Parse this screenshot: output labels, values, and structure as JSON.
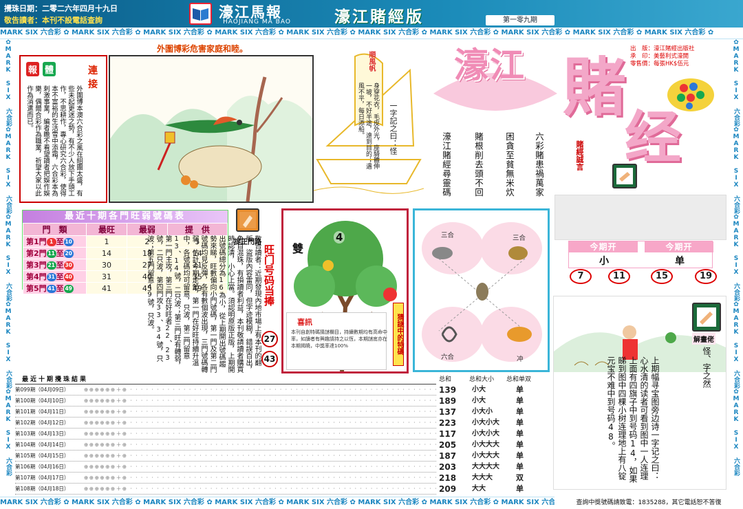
{
  "header": {
    "date": "攪珠日期：二零二六年四月十九日",
    "warning": "敬告讀者：本刊不設電話查詢",
    "paper_name": "濠江馬報",
    "paper_pinyin": "HAOJIANG MA BAO",
    "edition_title": "濠江賭經版",
    "issue_no": "第一零九期"
  },
  "frame": {
    "band_text": "MARK SIX 六合彩 ✿ MARK SIX 六合彩 ✿ MARK SIX 六合彩 ✿ MARK SIX 六合彩 ✿ MARK SIX 六合彩 ✿ MARK SIX 六合彩 ✿ MARK SIX 六合彩 ✿ MARK SIX 六合彩 ✿ MARK SIX 六合彩 ✿ MARK SIX 六合彩 ✿",
    "side_text": "✿MARK SIX 六合彩✿MARK SIX 六合彩✿MARK SIX 六合彩✿MARK SIX 六合彩✿MARK SIX 六合彩✿MARK SIX 六合彩✿MARK SIX 六合彩✿MARK SIX 六合彩"
  },
  "story": {
    "caption": "外圍博彩危害家庭和睦。",
    "tag_1": "報",
    "tag_2": "體",
    "heading": "連接",
    "text": "外圍博本澳六合彩之風在組團太盛，有些未起更迷之勢，有不少人放下手頭工作，不思耕作，專心研究六合彩，使得本不富裕的生活雪中添霜，六合彩本為刺激事業，編者瞻不看望讀者把娛作娛樂，偶爾合彩作為職業，祈望大家以此作為消遣而已。"
  },
  "ship": {
    "title": "順風帆",
    "heading": "一字記之曰：怪",
    "poem": "身穿花衣，毛皮外光，座騎體伸一坡，不好半途，遠到目的；遇風不平，每日添船。"
  },
  "proverbs": [
    "六彩賭患禍萬家",
    "困貪至貧無米炊",
    "賭根削去頭不回",
    "濠江賭經尋靈碼"
  ],
  "brand": {
    "title_1": "濠江",
    "title_2": "賭",
    "title_3": "经",
    "motto": "賭經誠言",
    "publisher_lines": [
      "出　版：濠江賭經出版社",
      "承　印：美藝利式濠開",
      "零售價：每張HK$伍元"
    ]
  },
  "stats_table": {
    "title": "最近十期各門旺弱號碼表",
    "headers": [
      "門　類",
      "最旺",
      "最弱",
      "提　供"
    ],
    "rows": [
      {
        "label": "第1門",
        "from": "1",
        "to": "10",
        "from_color": "#e33",
        "to_color": "#2b78d8",
        "hot": "1",
        "cold": "2",
        "offer": "5"
      },
      {
        "label": "第2門",
        "from": "11",
        "to": "20",
        "from_color": "#18a850",
        "to_color": "#2b78d8",
        "hot": "14",
        "cold": "18",
        "offer": "14"
      },
      {
        "label": "第3門",
        "from": "21",
        "to": "30",
        "from_color": "#18a850",
        "to_color": "#e33",
        "hot": "30",
        "cold": "27",
        "offer": "21"
      },
      {
        "label": "第4門",
        "from": "31",
        "to": "40",
        "from_color": "#2b78d8",
        "to_color": "#e33",
        "hot": "31",
        "cold": "40",
        "offer": "35"
      },
      {
        "label": "第5門",
        "from": "41",
        "to": "49",
        "from_color": "#2b78d8",
        "to_color": "#18a850",
        "hot": "41",
        "cold": "45",
        "offer": "49"
      }
    ],
    "separator": "至"
  },
  "ad": {
    "label": "捉正門路"
  },
  "notice": {
    "col_1": "敬告讀者：近期發現內地市場上有本刊的翻版，盜版內容雷同，但字迹模糊，錯誤百出，魚目混珠，有損讀者利益，本刊敬請讀者購買時認清，小心上當。須認明原版正版，上期開出號碼總分為16為小，從上期開出號碼趨勢來睇，旺數偏向小門號碼，第一門及第二門號碼均見反彈，各有數個波出現，三門號碼轉弱，估計今期走勢，第一門在好旺持續升溫中，各號碼均可留意，只波，第二門留意13、14號，二只波；第三門旺有轉弱，第一門主攻，第三門在好旺者22、23號，二只波，第四門攻33、34號，只波；第五門留意49號，只波。"
  },
  "lucky": {
    "title": "旺门号码当捧",
    "numbers": [
      "27",
      "43"
    ]
  },
  "tree": {
    "label_shuang": "雙",
    "number": "4",
    "side_label": "猜謎中的特碼",
    "news_title": "喜訊",
    "news_text": "本刊自創特碼猜謎欄目，持續數期均有高命中率，如讀者有興趣請持之以恆，本期謎底亦在本期揭曉，中獎率達100%"
  },
  "zodiac": {
    "top_left": "三合",
    "top_right": "三合",
    "bottom_left": "六合",
    "bottom_right": "冲"
  },
  "forecast": {
    "tab_1_title": "今期开",
    "tab_1_value": "小",
    "tab_2_title": "今期开",
    "tab_2_value": "单",
    "numbers": [
      "7",
      "11",
      "15",
      "19"
    ]
  },
  "results": {
    "title": "最近十期攪珠結果",
    "rows": [
      {
        "issue": "第099期（04月09日）"
      },
      {
        "issue": "第100期（04月10日）"
      },
      {
        "issue": "第101期（04月11日）"
      },
      {
        "issue": "第102期（04月12日）"
      },
      {
        "issue": "第103期（04月13日）"
      },
      {
        "issue": "第104期（04月14日）"
      },
      {
        "issue": "第105期（04月15日）"
      },
      {
        "issue": "第106期（04月16日）"
      },
      {
        "issue": "第107期（04月17日）"
      },
      {
        "issue": "第108期（04月18日）"
      }
    ],
    "dots": "⊕⊕⊕⊕⊕⊕＋⊕ · · · · · · · · · · · · · · · · · · · · · · · · · · · · · · · · · · · · · · · · · · · · · · · · · · · · · · · · · · · · · · ·"
  },
  "summary": {
    "head_total": "总和",
    "head_size": "总和大小",
    "head_odd": "总和单双",
    "rows": [
      {
        "total": "139",
        "size": "小大",
        "odd": "单"
      },
      {
        "total": "189",
        "size": "小大",
        "odd": "单"
      },
      {
        "total": "137",
        "size": "小大小",
        "odd": "单"
      },
      {
        "total": "223",
        "size": "小大小大",
        "odd": "单"
      },
      {
        "total": "117",
        "size": "小大小大",
        "odd": "单"
      },
      {
        "total": "205",
        "size": "小大大大",
        "odd": "单"
      },
      {
        "total": "187",
        "size": "小大大大",
        "odd": "单"
      },
      {
        "total": "203",
        "size": "大大大大",
        "odd": "单"
      },
      {
        "total": "218",
        "size": "大大大",
        "odd": "双"
      },
      {
        "total": "209",
        "size": "大大",
        "odd": "单"
      }
    ]
  },
  "puzzle": {
    "label": "解畫佬",
    "heading": "怪、字之然",
    "text": "上期幅寻宝图旁边诗一字记之曰：心水清的读者可看到图中一人连理上面有四旗子中到号码14，如果睇到图中四棵小树连理地上有八锭元宝不难中到号码48。"
  },
  "footer": {
    "phone": "查詢中獎號碼請致電：1835288，其它電話恕不答復"
  }
}
